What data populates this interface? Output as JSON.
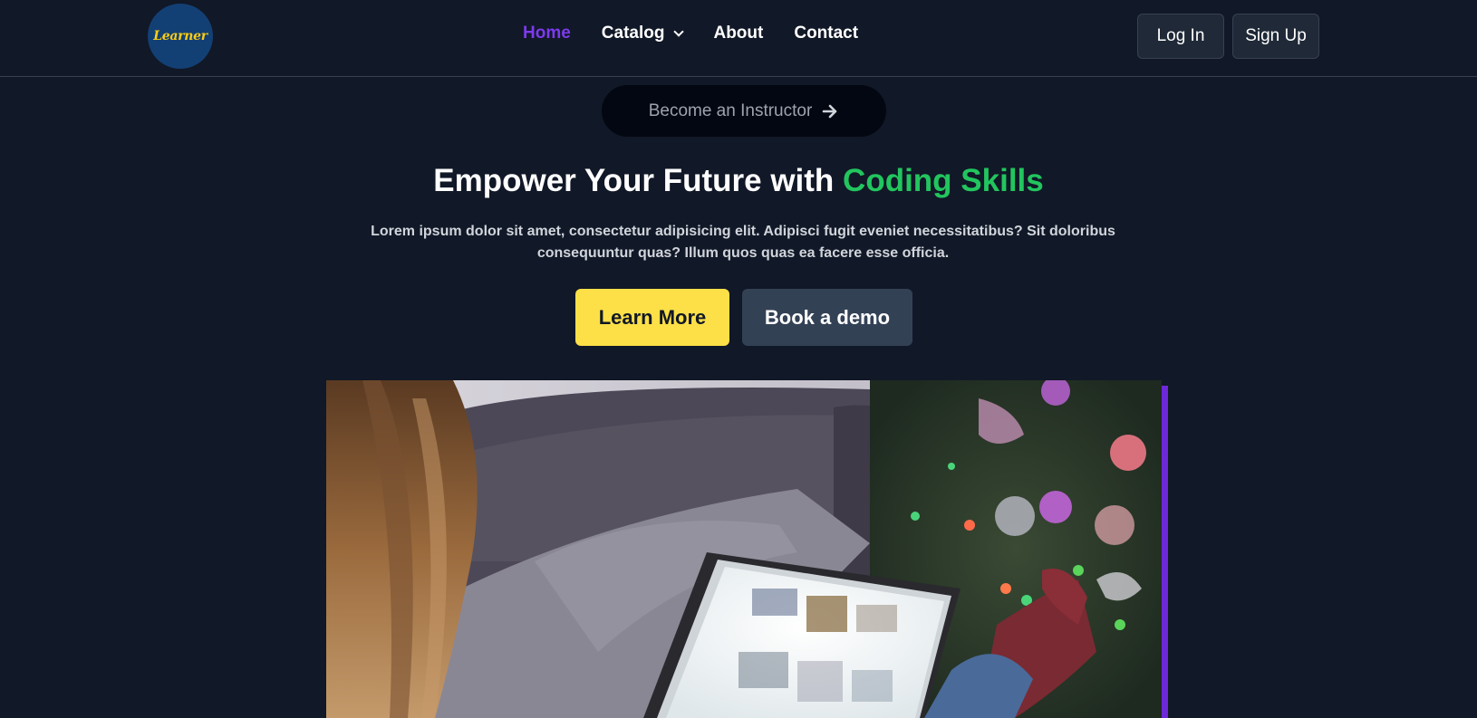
{
  "brand": {
    "logo_text": "Learner"
  },
  "nav": {
    "links": [
      {
        "label": "Home"
      },
      {
        "label": "Catalog"
      },
      {
        "label": "About"
      },
      {
        "label": "Contact"
      }
    ],
    "login_label": "Log In",
    "signup_label": "Sign Up"
  },
  "hero": {
    "instructor_label": "Become an Instructor",
    "headline_prefix": "Empower Your Future with ",
    "headline_highlight": "Coding Skills",
    "description": "Lorem ipsum dolor sit amet, consectetur adipisicing elit. Adipisci fugit eveniet necessitatibus? Sit doloribus consequuntur quas? Illum quos quas ea facere esse officia.",
    "learn_more_label": "Learn More",
    "book_demo_label": "Book a demo"
  },
  "colors": {
    "background": "#111827",
    "active_nav": "#7c3aed",
    "highlight_green": "#22c55e",
    "learn_more_bg": "#fde047",
    "demo_bg": "#334155",
    "accent_bar": "#6d28d9"
  },
  "icons": {
    "dropdown": "chevron-down-icon",
    "instructor_arrow": "arrow-right-icon"
  }
}
